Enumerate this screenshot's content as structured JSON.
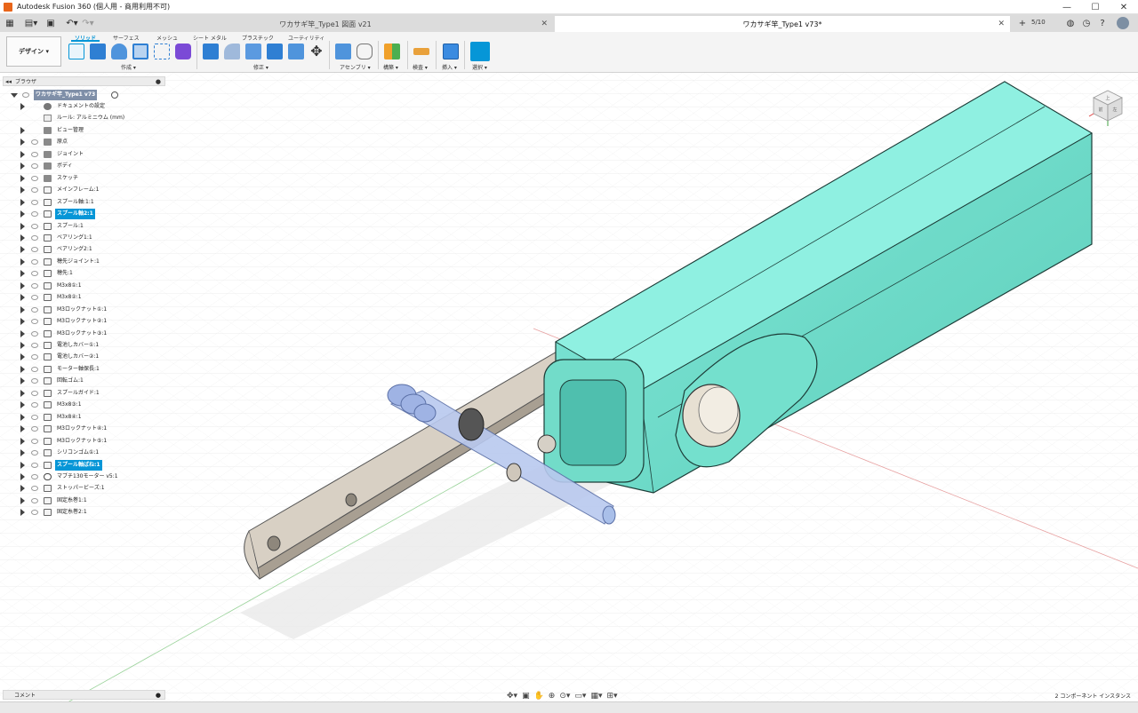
{
  "window": {
    "title": "Autodesk Fusion 360 (個人用 - 商用利用不可)",
    "controls": [
      "—",
      "☐",
      "✕"
    ]
  },
  "tabs": [
    {
      "label": "ワカサギ竿_Type1 図面 v21",
      "active": false
    },
    {
      "label": "ワカサギ竿_Type1 v73*",
      "active": true
    }
  ],
  "tabbar_right": {
    "job_status": "5/10"
  },
  "toolbar": {
    "workspace": "デザイン ▾",
    "ribbon_tabs": [
      "ソリッド",
      "サーフェス",
      "メッシュ",
      "シート メタル",
      "プラスチック",
      "ユーティリティ"
    ],
    "groups": [
      "作成 ▾",
      "修正 ▾",
      "アセンブリ ▾",
      "構築 ▾",
      "検査 ▾",
      "挿入 ▾",
      "選択 ▾"
    ]
  },
  "browser": {
    "header": "ブラウザ",
    "root": "ワカサギ竿_Type1 v73",
    "items": [
      {
        "label": "ドキュメントの設定",
        "icon": "gear-icon",
        "eye": false,
        "arrow": true,
        "selected": false
      },
      {
        "label": "ルール: アルミニウム (mm)",
        "icon": "units-icon",
        "eye": false,
        "arrow": false,
        "selected": false
      },
      {
        "label": "ビュー管理",
        "icon": "folder-icon",
        "eye": false,
        "arrow": true,
        "selected": false
      },
      {
        "label": "原点",
        "icon": "folder-icon",
        "eye": true,
        "arrow": true,
        "selected": false
      },
      {
        "label": "ジョイント",
        "icon": "folder-icon",
        "eye": true,
        "arrow": true,
        "selected": false
      },
      {
        "label": "ボディ",
        "icon": "folder-icon",
        "eye": true,
        "arrow": true,
        "selected": false
      },
      {
        "label": "スケッチ",
        "icon": "folder-icon",
        "eye": true,
        "arrow": true,
        "selected": false
      },
      {
        "label": "メインフレーム:1",
        "icon": "component-icon",
        "eye": true,
        "arrow": true,
        "selected": false
      },
      {
        "label": "スプール軸:1:1",
        "icon": "component-icon",
        "eye": true,
        "arrow": true,
        "selected": false
      },
      {
        "label": "スプール軸2:1",
        "icon": "component-icon",
        "eye": true,
        "arrow": true,
        "selected": true
      },
      {
        "label": "スプール:1",
        "icon": "component-icon",
        "eye": true,
        "arrow": true,
        "selected": false
      },
      {
        "label": "ベアリング1:1",
        "icon": "component-icon",
        "eye": true,
        "arrow": true,
        "selected": false
      },
      {
        "label": "ベアリング2:1",
        "icon": "component-icon",
        "eye": true,
        "arrow": true,
        "selected": false
      },
      {
        "label": "穂先ジョイント:1",
        "icon": "component-icon",
        "eye": true,
        "arrow": true,
        "selected": false
      },
      {
        "label": "穂先:1",
        "icon": "component-icon",
        "eye": true,
        "arrow": true,
        "selected": false
      },
      {
        "label": "M3x8①:1",
        "icon": "component-icon",
        "eye": true,
        "arrow": true,
        "selected": false
      },
      {
        "label": "M3x8②:1",
        "icon": "component-icon",
        "eye": true,
        "arrow": true,
        "selected": false
      },
      {
        "label": "M3ロックナット①:1",
        "icon": "component-icon",
        "eye": true,
        "arrow": true,
        "selected": false
      },
      {
        "label": "M3ロックナット②:1",
        "icon": "component-icon",
        "eye": true,
        "arrow": true,
        "selected": false
      },
      {
        "label": "M3ロックナット③:1",
        "icon": "component-icon",
        "eye": true,
        "arrow": true,
        "selected": false
      },
      {
        "label": "電池しカバー①:1",
        "icon": "component-icon",
        "eye": true,
        "arrow": true,
        "selected": false
      },
      {
        "label": "電池しカバー②:1",
        "icon": "component-icon",
        "eye": true,
        "arrow": true,
        "selected": false
      },
      {
        "label": "モーター軸保長:1",
        "icon": "component-icon",
        "eye": true,
        "arrow": true,
        "selected": false
      },
      {
        "label": "回転ゴム:1",
        "icon": "component-icon",
        "eye": true,
        "arrow": true,
        "selected": false
      },
      {
        "label": "スプールガイド:1",
        "icon": "component-icon",
        "eye": true,
        "arrow": true,
        "selected": false
      },
      {
        "label": "M3x8③:1",
        "icon": "component-icon",
        "eye": true,
        "arrow": true,
        "selected": false
      },
      {
        "label": "M3x8④:1",
        "icon": "component-icon",
        "eye": true,
        "arrow": true,
        "selected": false
      },
      {
        "label": "M3ロックナット④:1",
        "icon": "component-icon",
        "eye": true,
        "arrow": true,
        "selected": false
      },
      {
        "label": "M3ロックナット⑤:1",
        "icon": "component-icon",
        "eye": true,
        "arrow": true,
        "selected": false
      },
      {
        "label": "シリコンゴム①:1",
        "icon": "component-icon",
        "eye": true,
        "arrow": true,
        "selected": false
      },
      {
        "label": "スプール軸ばね:1",
        "icon": "component-icon",
        "eye": true,
        "arrow": true,
        "selected": true
      },
      {
        "label": "マブチ130モーター v5:1",
        "icon": "link-icon",
        "eye": true,
        "arrow": true,
        "selected": false
      },
      {
        "label": "ストッパービーズ:1",
        "icon": "component-icon",
        "eye": true,
        "arrow": true,
        "selected": false
      },
      {
        "label": "固定糸巻1:1",
        "icon": "component-icon",
        "eye": true,
        "arrow": true,
        "selected": false
      },
      {
        "label": "固定糸巻2:1",
        "icon": "component-icon",
        "eye": true,
        "arrow": true,
        "selected": false
      }
    ]
  },
  "comments": {
    "label": "コメント"
  },
  "status": {
    "right": "2 コンポーネント インスタンス"
  },
  "viewcube": {
    "top": "上",
    "front": "前",
    "right": "左"
  },
  "colors": {
    "accent": "#0696d7",
    "body_teal": "#6fe0cc",
    "plate": "#cfc7bb",
    "transparent_part": "#a9bfe9"
  }
}
